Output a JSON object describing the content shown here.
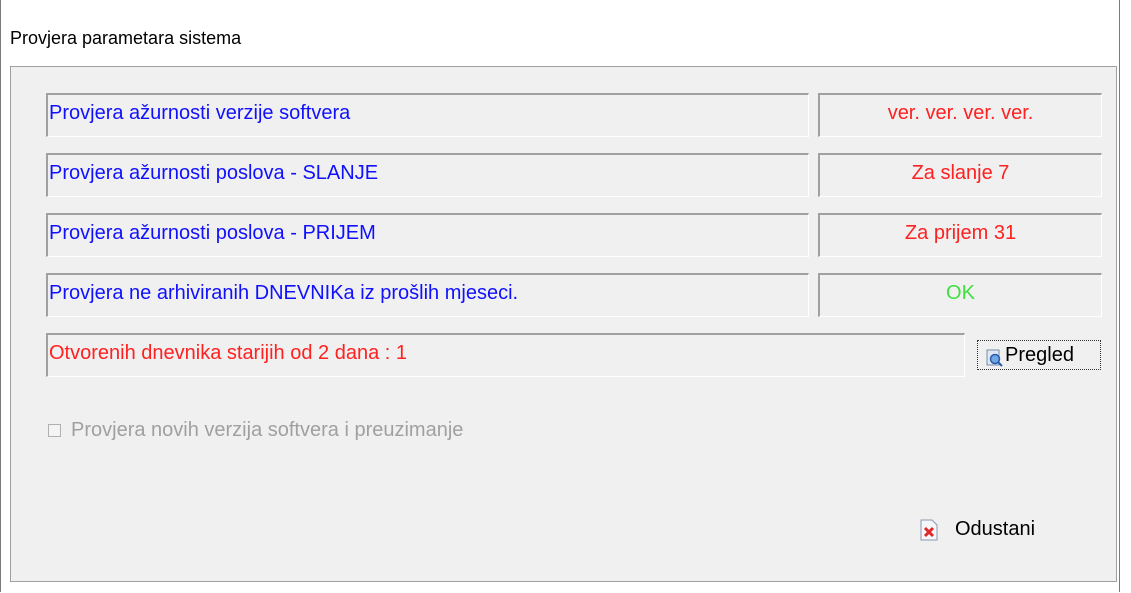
{
  "window": {
    "title": "Provjera parametara sistema"
  },
  "checks": [
    {
      "label": "Provjera ažurnosti verzije softvera",
      "value": "ver. ver. ver. ver."
    },
    {
      "label": "Provjera ažurnosti poslova - SLANJE",
      "value": "Za slanje 7"
    },
    {
      "label": "Provjera ažurnosti poslova - PRIJEM",
      "value": "Za prijem 31"
    },
    {
      "label": "Provjera ne arhiviranih DNEVNIKa iz prošlih mjeseci.",
      "value": "OK"
    }
  ],
  "journals": {
    "message": "Otvorenih dnevnika starijih od 2 dana : 1",
    "preview_label": "Pregled"
  },
  "update_checkbox": {
    "label": "Provjera novih verzija softvera i preuzimanje",
    "checked": false,
    "enabled": false
  },
  "footer": {
    "cancel_label": "Odustani"
  },
  "colors": {
    "label_text": "#1010ff",
    "warning_text": "#ff2020",
    "ok_text": "#40e040",
    "disabled_text": "#a0a0a0"
  },
  "icons": {
    "preview": "magnifier-icon",
    "cancel": "close-document-icon"
  }
}
